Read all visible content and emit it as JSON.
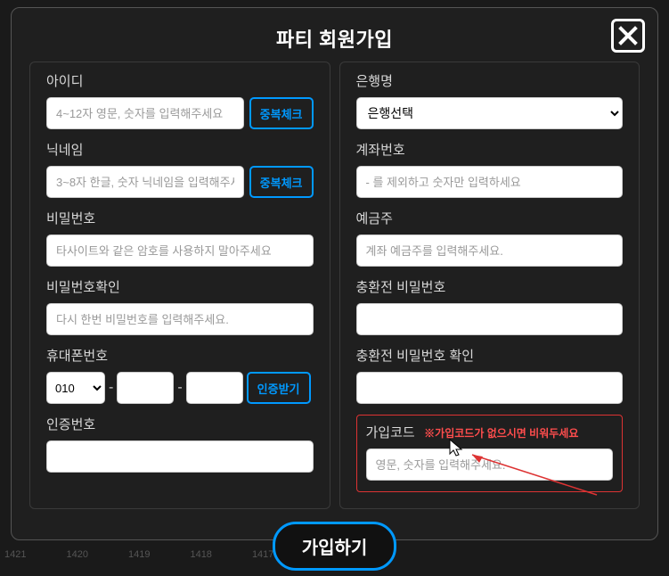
{
  "modal": {
    "title": "파티 회원가입",
    "submit": "가입하기"
  },
  "left": {
    "id_label": "아이디",
    "id_placeholder": "4~12자 영문, 숫자를 입력해주세요",
    "id_check": "중복체크",
    "nick_label": "닉네임",
    "nick_placeholder": "3~8자 한글, 숫자 닉네임을 입력해주세",
    "nick_check": "중복체크",
    "pw_label": "비밀번호",
    "pw_placeholder": "타사이트와 같은 암호를 사용하지 말아주세요",
    "pw2_label": "비밀번호확인",
    "pw2_placeholder": "다시 한번 비밀번호를 입력해주세요.",
    "phone_label": "휴대폰번호",
    "phone_prefix": "010",
    "phone_verify": "인증받기",
    "code_label": "인증번호"
  },
  "right": {
    "bank_label": "은행명",
    "bank_selected": "은행선택",
    "acct_label": "계좌번호",
    "acct_placeholder": "- 를 제외하고 숫자만 입력하세요",
    "holder_label": "예금주",
    "holder_placeholder": "계좌 예금주를 입력해주세요.",
    "xpw_label": "충환전 비밀번호",
    "xpw2_label": "충환전 비밀번호 확인",
    "code_label": "가입코드",
    "code_hint": "※가입코드가 없으시면 비워두세요",
    "code_placeholder": "영문, 숫자를 입력해주세요."
  },
  "bg_ticks": [
    "1421",
    "1420",
    "1419",
    "1418",
    "1417"
  ]
}
